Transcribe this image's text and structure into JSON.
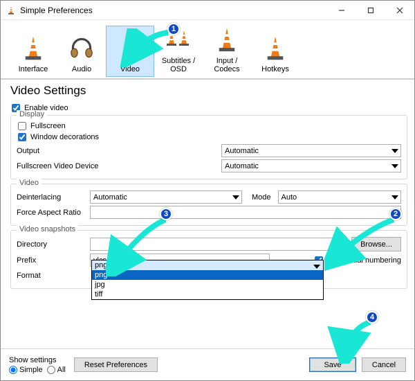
{
  "window": {
    "title": "Simple Preferences"
  },
  "categories": [
    {
      "id": "interface",
      "label": "Interface"
    },
    {
      "id": "audio",
      "label": "Audio"
    },
    {
      "id": "video",
      "label": "Video",
      "selected": true
    },
    {
      "id": "subs",
      "label": "Subtitles / OSD"
    },
    {
      "id": "input",
      "label": "Input / Codecs"
    },
    {
      "id": "hotkeys",
      "label": "Hotkeys"
    }
  ],
  "page_title": "Video Settings",
  "enable_video": {
    "label": "Enable video",
    "checked": true
  },
  "group_display": {
    "title": "Display",
    "fullscreen": {
      "label": "Fullscreen",
      "checked": false
    },
    "window_decorations": {
      "label": "Window decorations",
      "checked": true
    },
    "output": {
      "label": "Output",
      "value": "Automatic"
    },
    "fs_device": {
      "label": "Fullscreen Video Device",
      "value": "Automatic"
    }
  },
  "group_video": {
    "title": "Video",
    "deinterlacing": {
      "label": "Deinterlacing",
      "value": "Automatic"
    },
    "mode": {
      "label": "Mode",
      "value": "Auto"
    },
    "force_aspect": {
      "label": "Force Aspect Ratio",
      "value": ""
    }
  },
  "group_snapshots": {
    "title": "Video snapshots",
    "directory": {
      "label": "Directory",
      "value": "",
      "browse": "Browse..."
    },
    "prefix": {
      "label": "Prefix",
      "value": "vlcsnap-",
      "sequential": "Sequential numbering",
      "sequential_checked": true
    },
    "format": {
      "label": "Format",
      "value": "png",
      "options": [
        "png",
        "jpg",
        "tiff"
      ]
    }
  },
  "bottom": {
    "show_settings_label": "Show settings",
    "simple": "Simple",
    "all": "All",
    "reset": "Reset Preferences",
    "save": "Save",
    "cancel": "Cancel"
  },
  "annotations": {
    "1": "1",
    "2": "2",
    "3": "3",
    "4": "4"
  }
}
